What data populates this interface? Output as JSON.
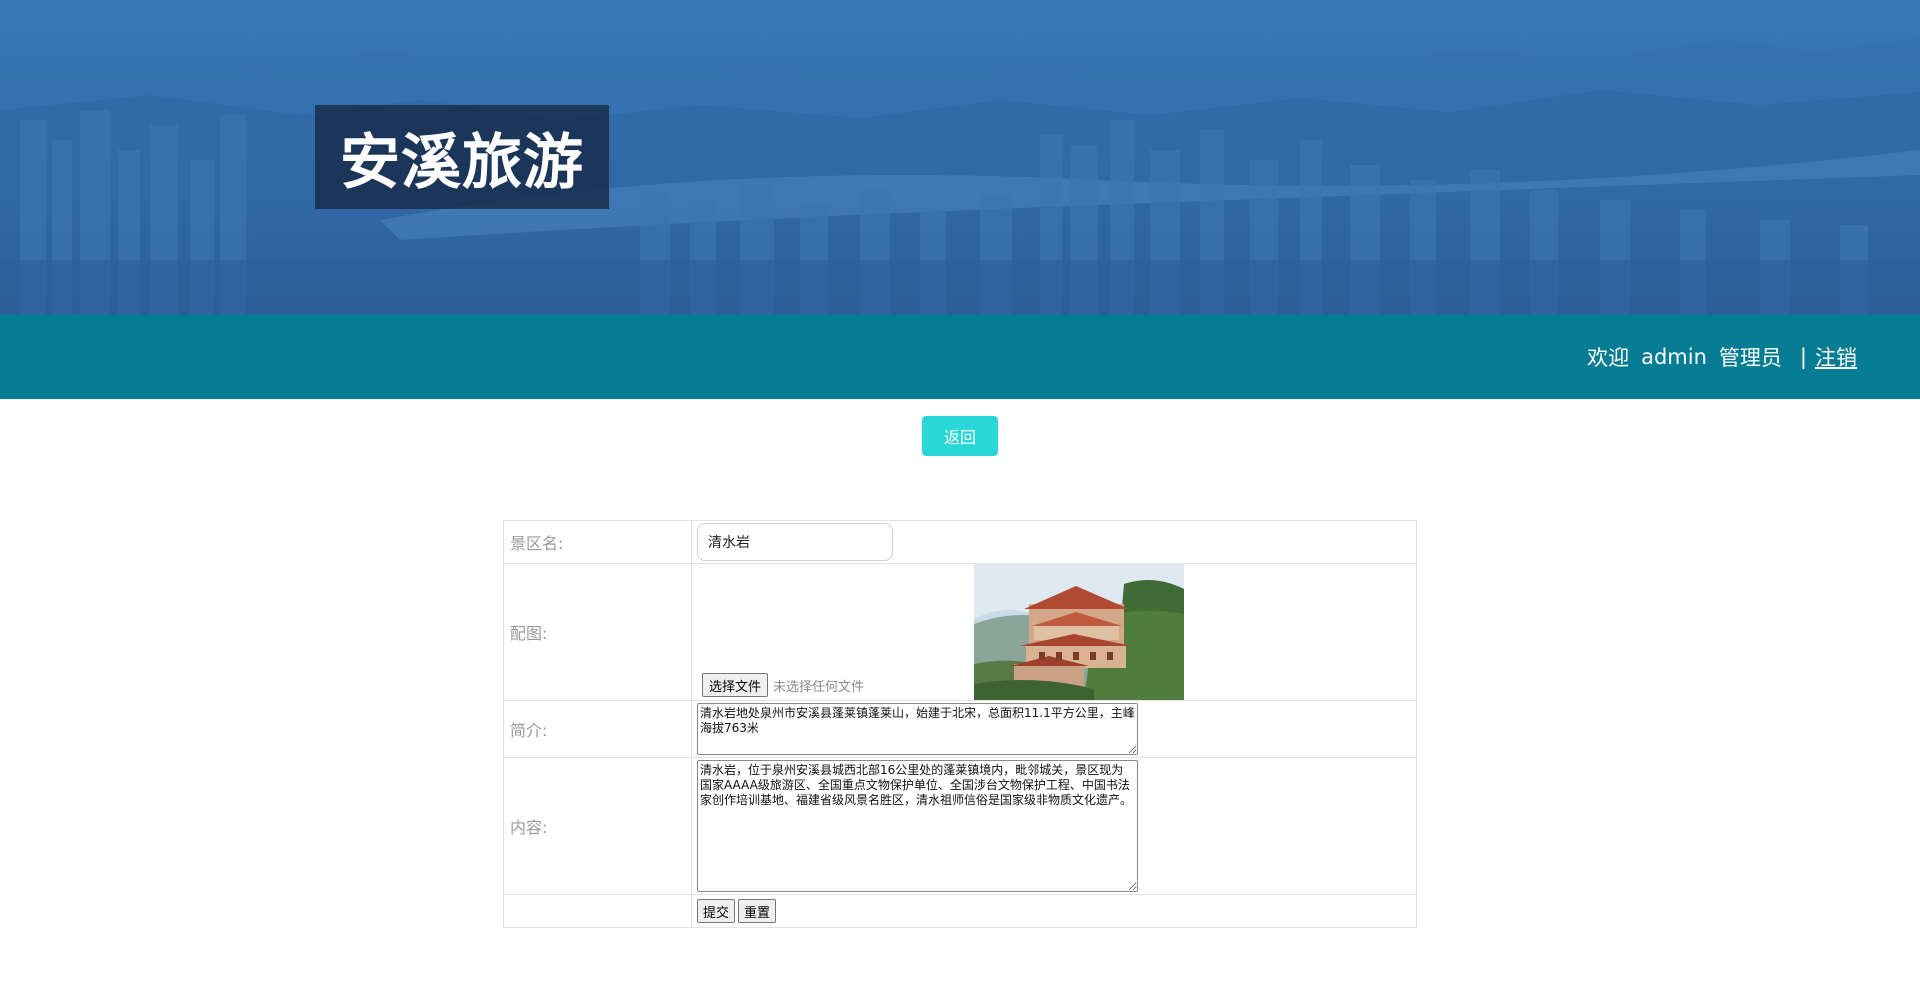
{
  "header": {
    "logo_text": "安溪旅游"
  },
  "navbar": {
    "welcome": "欢迎",
    "username": "admin",
    "role": "管理员",
    "separator": "|",
    "logout_label": "注销"
  },
  "back_button_label": "返回",
  "form": {
    "name_label": "景区名:",
    "name_value": "清水岩",
    "image_label": "配图:",
    "file_button_label": "选择文件",
    "file_status": "未选择任何文件",
    "intro_label": "简介:",
    "intro_value": "清水岩地处泉州市安溪县蓬莱镇蓬莱山，始建于北宋，总面积11.1平方公里，主峰海拔763米",
    "content_label": "内容:",
    "content_value": "清水岩，位于泉州安溪县城西北部16公里处的蓬莱镇境内，毗邻城关，景区现为国家AAAA级旅游区、全国重点文物保护单位、全国涉台文物保护工程、中国书法家创作培训基地、福建省级风景名胜区，清水祖师信俗是国家级非物质文化遗产。",
    "submit_label": "提交",
    "reset_label": "重置"
  },
  "colors": {
    "navbar": "#047c94",
    "back_button": "#29d6d8",
    "banner": "#2f66a3"
  }
}
